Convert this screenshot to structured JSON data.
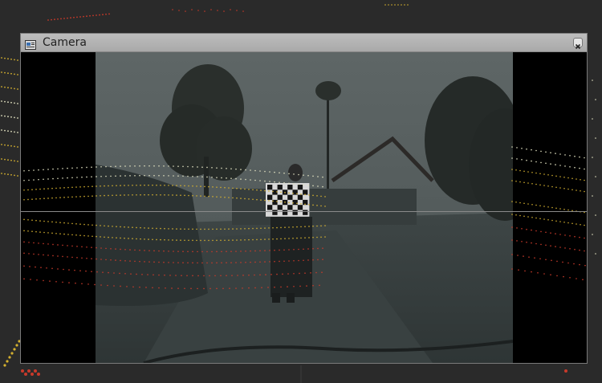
{
  "window": {
    "title": "Camera",
    "close_icon": "close-icon",
    "app_icon": "camera-window-icon"
  },
  "scene": {
    "description_icon": "camera-feed-image"
  },
  "colors": {
    "titlebar": "#b3b3b3",
    "background": "#2a2a2a",
    "points_near": "#c83a2a",
    "points_mid": "#d4b030",
    "points_far": "#e0e0c0"
  }
}
